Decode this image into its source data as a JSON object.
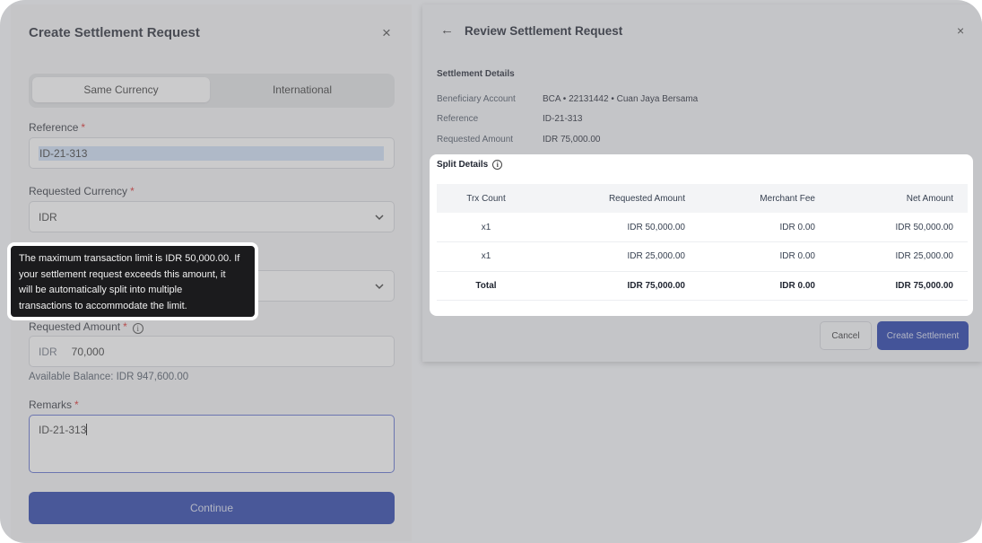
{
  "create_form": {
    "title": "Create Settlement Request",
    "close_icon": "×",
    "tabs": [
      {
        "label": "Same Currency",
        "active": true
      },
      {
        "label": "International",
        "active": false
      }
    ],
    "reference": {
      "label": "Reference",
      "required_mark": "*",
      "value": "ID-21-313"
    },
    "currency": {
      "label": "Requested Currency",
      "required_mark": "*",
      "value": "IDR"
    },
    "amount": {
      "label": "Requested Amount",
      "required_mark": "*",
      "prefix": "IDR",
      "value": "70,000"
    },
    "balance_text": "Available Balance: IDR 947,600.00",
    "remarks": {
      "label": "Remarks",
      "required_mark": "*",
      "value": "ID-21-313"
    },
    "continue_label": "Continue"
  },
  "tooltip": {
    "lines": [
      "The maximum transaction limit is IDR 50,000.00. If",
      "your settlement request exceeds this amount, it",
      "will be automatically split into multiple",
      "transactions to accommodate the limit."
    ]
  },
  "review": {
    "title": "Review Settlement Request",
    "back_icon": "←",
    "close_icon": "×",
    "section_title": "Settlement Details",
    "details": [
      {
        "key": "Beneficiary Account",
        "value": "BCA • 22131442 • Cuan Jaya Bersama"
      },
      {
        "key": "Reference",
        "value": "ID-21-313"
      },
      {
        "key": "Requested Amount",
        "value": "IDR 75,000.00"
      }
    ],
    "split": {
      "title": "Split Details",
      "columns": [
        "Trx Count",
        "Requested Amount",
        "Merchant Fee",
        "Net Amount"
      ],
      "rows": [
        [
          "x1",
          "IDR 50,000.00",
          "IDR 0.00",
          "IDR 50,000.00"
        ],
        [
          "x1",
          "IDR 25,000.00",
          "IDR 0.00",
          "IDR 25,000.00"
        ]
      ],
      "total": [
        "Total",
        "IDR 75,000.00",
        "IDR 0.00",
        "IDR 75,000.00"
      ]
    },
    "cancel_label": "Cancel",
    "create_label": "Create Settlement"
  },
  "colors": {
    "primary": "#1f3aa8",
    "required": "#dc2626",
    "tooltip_bg": "#1b1b1d"
  }
}
